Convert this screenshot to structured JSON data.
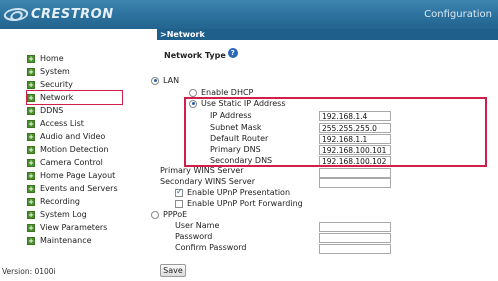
{
  "header": {
    "brand": "CRESTRON",
    "title": "Configuration"
  },
  "subheader": {
    "breadcrumb": ">Network"
  },
  "sidebar": {
    "items": [
      {
        "label": "Home"
      },
      {
        "label": "System"
      },
      {
        "label": "Security"
      },
      {
        "label": "Network"
      },
      {
        "label": "DDNS"
      },
      {
        "label": "Access List"
      },
      {
        "label": "Audio and Video"
      },
      {
        "label": "Motion Detection"
      },
      {
        "label": "Camera Control"
      },
      {
        "label": "Home Page Layout"
      },
      {
        "label": "Events and Servers"
      },
      {
        "label": "Recording"
      },
      {
        "label": "System Log"
      },
      {
        "label": "View Parameters"
      },
      {
        "label": "Maintenance"
      }
    ],
    "active": "Network",
    "version": "Version: 0100i"
  },
  "form": {
    "network_type_label": "Network Type",
    "help_icon": "?",
    "lan_label": "LAN",
    "enable_dhcp_label": "Enable DHCP",
    "use_static_ip_label": "Use Static IP Address",
    "fields": {
      "ip_address": {
        "label": "IP Address",
        "value": "192.168.1.4"
      },
      "subnet_mask": {
        "label": "Subnet Mask",
        "value": "255.255.255.0"
      },
      "default_router": {
        "label": "Default Router",
        "value": "192.168.1.1"
      },
      "primary_dns": {
        "label": "Primary DNS",
        "value": "192.168.100.101"
      },
      "secondary_dns": {
        "label": "Secondary DNS",
        "value": "192.168.100.102"
      },
      "primary_wins": {
        "label": "Primary WINS Server",
        "value": ""
      },
      "secondary_wins": {
        "label": "Secondary WINS Server",
        "value": ""
      }
    },
    "enable_upnp_presentation_label": "Enable UPnP Presentation",
    "enable_upnp_port_forwarding_label": "Enable UPnP Port Forwarding",
    "pppoe_label": "PPPoE",
    "pppoe_fields": {
      "user_name": {
        "label": "User Name",
        "value": ""
      },
      "password": {
        "label": "Password",
        "value": ""
      },
      "confirm_password": {
        "label": "Confirm Password",
        "value": ""
      }
    },
    "save_label": "Save"
  },
  "colors": {
    "header_bg": "#2a6f9c",
    "subheader_bg": "#1f5f8b",
    "highlight_outline": "#d21f4a",
    "nav_plus": "#4a8f2c"
  }
}
